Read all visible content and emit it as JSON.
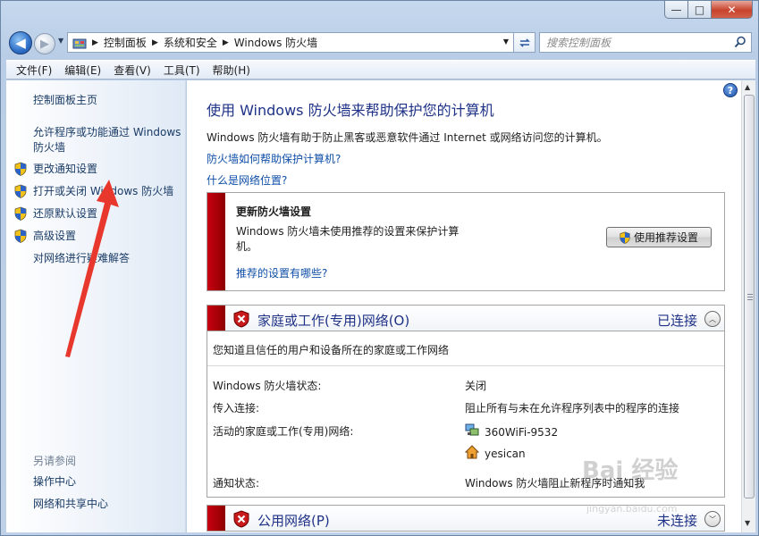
{
  "window": {
    "min": "—",
    "max": "□",
    "close": "✕"
  },
  "nav": {
    "back": "◀",
    "forward": "▶",
    "dropdown": "▼"
  },
  "address": {
    "crumbs": [
      "控制面板",
      "系统和安全",
      "Windows 防火墙"
    ],
    "sep": "▶",
    "dd": "▼"
  },
  "search": {
    "placeholder": "搜索控制面板"
  },
  "menu": [
    "文件(F)",
    "编辑(E)",
    "查看(V)",
    "工具(T)",
    "帮助(H)"
  ],
  "left": {
    "home": "控制面板主页",
    "allow_line1": "允许程序或功能通过 Windows",
    "allow_line2": "防火墙",
    "items": [
      "更改通知设置",
      "打开或关闭 Windows 防火墙",
      "还原默认设置",
      "高级设置"
    ],
    "troubleshoot": "对网络进行疑难解答",
    "see_also": "另请参阅",
    "action_center": "操作中心",
    "network_center": "网络和共享中心"
  },
  "main": {
    "help": "?",
    "title": "使用 Windows 防火墙来帮助保护您的计算机",
    "desc": "Windows 防火墙有助于防止黑客或恶意软件通过 Internet 或网络访问您的计算机。",
    "link1": "防火墙如何帮助保护计算机?",
    "link2": "什么是网络位置?"
  },
  "update": {
    "heading": "更新防火墙设置",
    "text": "Windows 防火墙未使用推荐的设置来保护计算机。",
    "link": "推荐的设置有哪些?",
    "button": "使用推荐设置"
  },
  "home_net": {
    "name": "家庭或工作(专用)网络(O)",
    "status": "已连接",
    "chev": "︿",
    "intro": "您知道且信任的用户和设备所在的家庭或工作网络",
    "rows": [
      {
        "k": "Windows 防火墙状态:",
        "v": "关闭"
      },
      {
        "k": "传入连接:",
        "v": "阻止所有与未在允许程序列表中的程序的连接"
      },
      {
        "k": "活动的家庭或工作(专用)网络:",
        "v": "360WiFi-9532"
      },
      {
        "k": "",
        "v": "yesican"
      },
      {
        "k": "通知状态:",
        "v": "Windows 防火墙阻止新程序时通知我"
      }
    ]
  },
  "public_net": {
    "name": "公用网络(P)",
    "status": "未连接",
    "chev": "﹀"
  },
  "scroll": {
    "up": "▲",
    "down": "▼"
  },
  "watermark": {
    "text": "Bai 经验",
    "sub": "jingyan.baidu.com"
  }
}
